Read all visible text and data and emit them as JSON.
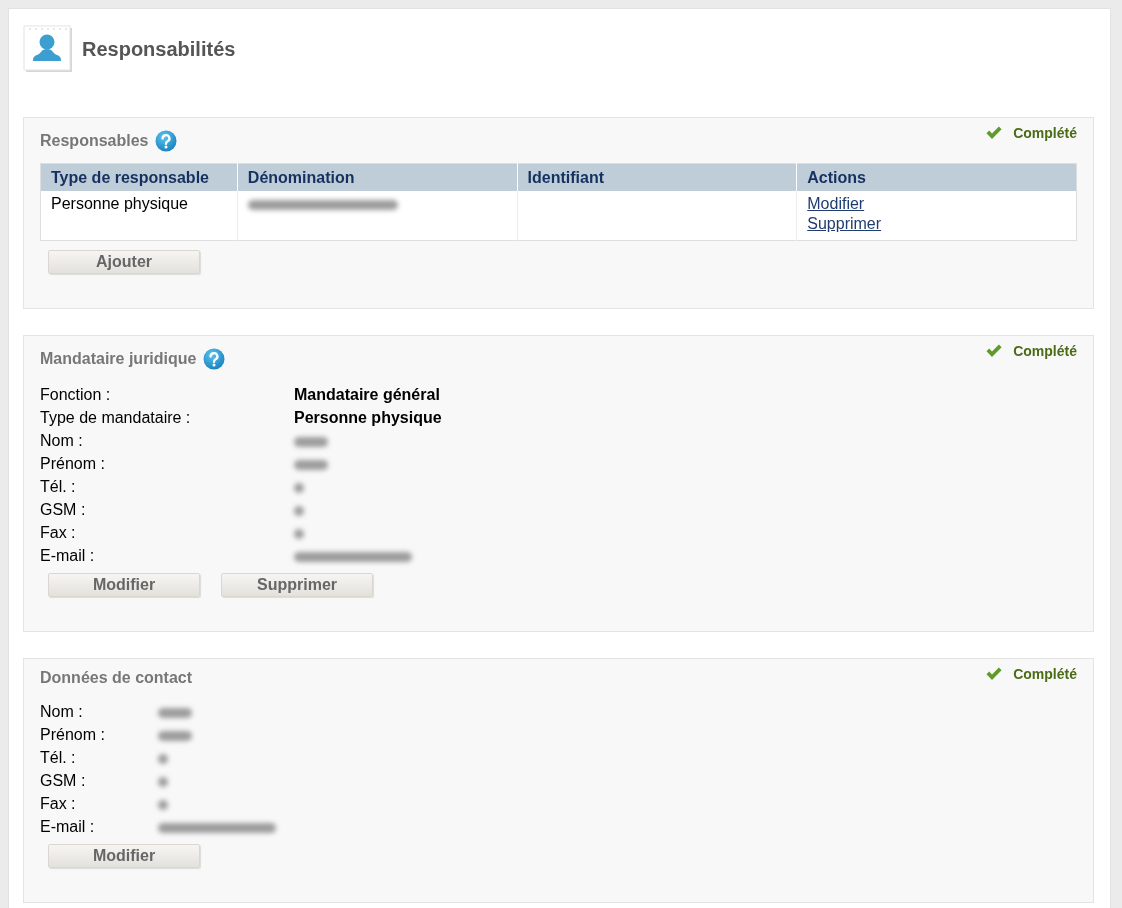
{
  "page": {
    "title": "Responsabilités"
  },
  "sections": [
    {
      "kind": "table",
      "title": "Responsables",
      "help": true,
      "status": {
        "kind": "complete",
        "label": "Complété"
      },
      "table": {
        "columns": [
          "Type de responsable",
          "Dénomination",
          "Identifiant",
          "Actions"
        ],
        "rows": [
          {
            "cells": [
              {
                "kind": "text",
                "value": "Personne physique"
              },
              {
                "kind": "blur_wide"
              },
              {
                "kind": "empty"
              },
              {
                "kind": "links",
                "links": [
                  "Modifier",
                  "Supprimer"
                ]
              }
            ]
          }
        ]
      },
      "buttons": [
        "Ajouter"
      ]
    },
    {
      "kind": "mandate",
      "title": "Mandataire juridique",
      "help": true,
      "status": {
        "kind": "complete",
        "label": "Complété"
      },
      "fields": [
        {
          "label": "Fonction :",
          "kind": "text",
          "value": "Mandataire général"
        },
        {
          "label": "Type de mandataire :",
          "kind": "text",
          "value": "Personne physique"
        },
        {
          "label": "Nom :",
          "kind": "blur_short"
        },
        {
          "label": "Prénom :",
          "kind": "blur_short"
        },
        {
          "label": "Tél. :",
          "kind": "blur_tiny"
        },
        {
          "label": "GSM :",
          "kind": "blur_tiny"
        },
        {
          "label": "Fax :",
          "kind": "blur_tiny"
        },
        {
          "label": "E-mail :",
          "kind": "blur_long"
        }
      ],
      "buttons": [
        "Modifier",
        "Supprimer"
      ]
    },
    {
      "kind": "contact",
      "title": "Données de contact",
      "help": false,
      "status": {
        "kind": "complete",
        "label": "Complété"
      },
      "fields": [
        {
          "label": "Nom :",
          "kind": "blur_short"
        },
        {
          "label": "Prénom :",
          "kind": "blur_short"
        },
        {
          "label": "Tél. :",
          "kind": "blur_tiny"
        },
        {
          "label": "GSM :",
          "kind": "blur_tiny"
        },
        {
          "label": "Fax :",
          "kind": "blur_tiny"
        },
        {
          "label": "E-mail :",
          "kind": "blur_long"
        }
      ],
      "buttons": [
        "Modifier"
      ]
    }
  ]
}
